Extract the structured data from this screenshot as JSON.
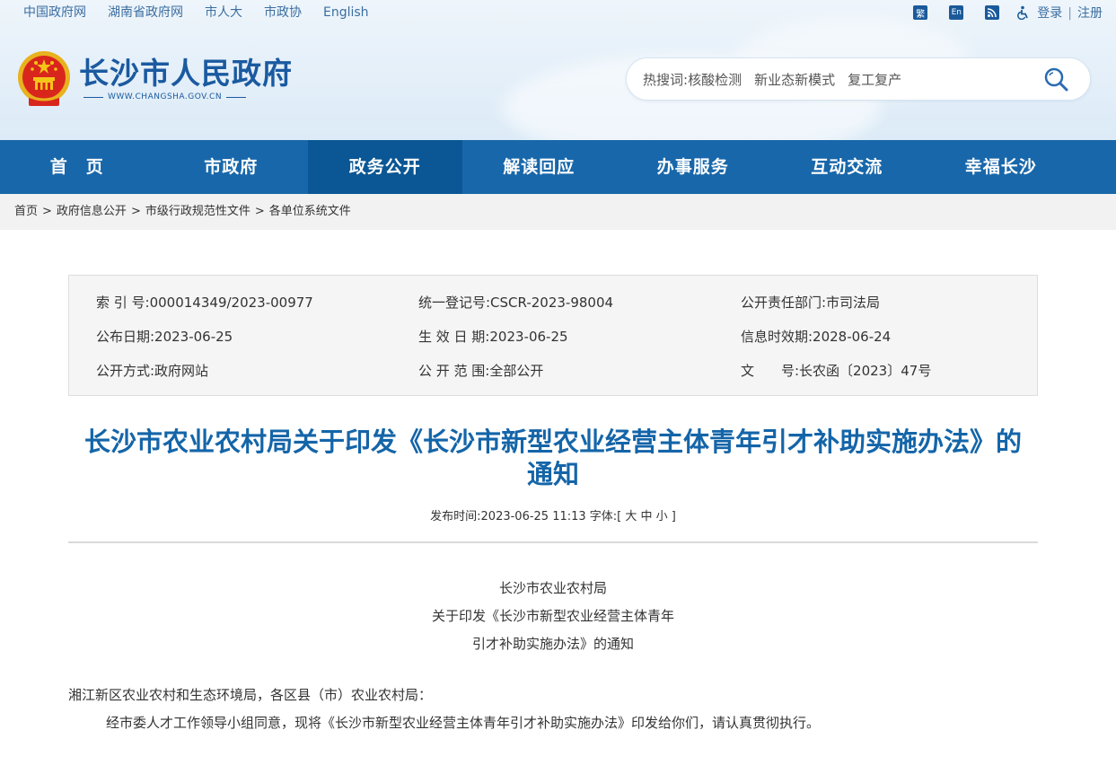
{
  "top_links": [
    "中国政府网",
    "湖南省政府网",
    "市人大",
    "市政协",
    "English"
  ],
  "top_right": {
    "traditional_icon_label": "繁",
    "english_icon_label": "En",
    "login": "登录",
    "separator": "|",
    "register": "注册"
  },
  "brand": {
    "title": "长沙市人民政府",
    "url": "WWW.CHANGSHA.GOV.CN"
  },
  "search": {
    "hot_label": "热搜词:",
    "keywords": [
      "核酸检测",
      "新业态新模式",
      "复工复产"
    ]
  },
  "nav": [
    "首　页",
    "市政府",
    "政务公开",
    "解读回应",
    "办事服务",
    "互动交流",
    "幸福长沙"
  ],
  "breadcrumb": [
    "首页",
    "政府信息公开",
    "市级行政规范性文件",
    "各单位系统文件"
  ],
  "meta": {
    "index_no": "索 引 号:000014349/2023-00977",
    "reg_no": "统一登记号:CSCR-2023-98004",
    "dept": "公开责任部门:市司法局",
    "pub_date": "公布日期:2023-06-25",
    "eff_date": "生 效 日 期:2023-06-25",
    "expire": "信息时效期:2028-06-24",
    "method": "公开方式:政府网站",
    "scope": "公 开 范 围:全部公开",
    "doc_no": "文　　号:长农函〔2023〕47号"
  },
  "title": "长沙市农业农村局关于印发《长沙市新型农业经营主体青年引才补助实施办法》的通知",
  "pubinfo": "发布时间:2023-06-25 11:13   字体:[ 大 中 小 ]",
  "body": {
    "center_lines": [
      "长沙市农业农村局",
      "关于印发《长沙市新型农业经营主体青年",
      "引才补助实施办法》的通知"
    ],
    "addressee": "湘江新区农业农村和生态环境局，各区县（市）农业农村局：",
    "para1": "经市委人才工作领导小组同意，现将《长沙市新型农业经营主体青年引才补助实施办法》印发给你们，请认真贯彻执行。"
  },
  "colors": {
    "primary": "#1867aa",
    "active_nav": "#0b5694",
    "title": "#1465a8"
  }
}
